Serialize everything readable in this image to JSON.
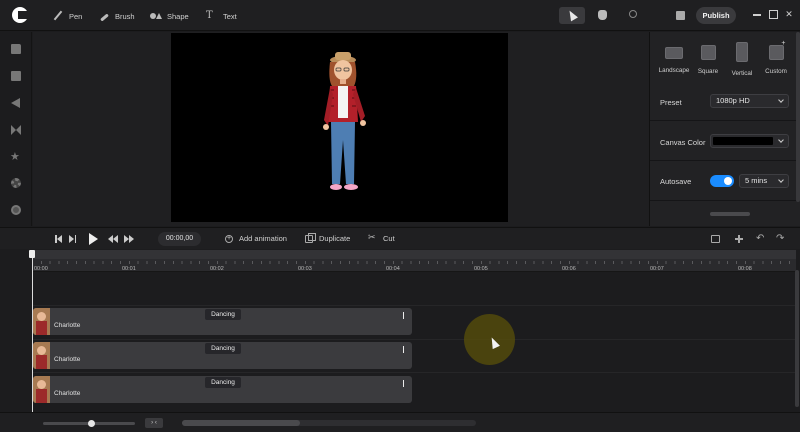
{
  "toolbar": {
    "tools": [
      {
        "label": "Pen",
        "icon": "pen-icon"
      },
      {
        "label": "Brush",
        "icon": "brush-icon"
      },
      {
        "label": "Shape",
        "icon": "shape-icon"
      },
      {
        "label": "Text",
        "icon": "text-icon"
      }
    ],
    "text_glyph": "T",
    "publish_label": "Publish",
    "close_glyph": "✕"
  },
  "right_panel": {
    "ratios": [
      "Landscape",
      "Square",
      "Vertical",
      "Custom"
    ],
    "preset_label": "Preset",
    "preset_value": "1080p HD",
    "canvas_color_label": "Canvas Color",
    "canvas_color": "#000000",
    "autosave_label": "Autosave",
    "autosave_on": true,
    "autosave_interval": "5 mins"
  },
  "transport": {
    "timecode": "00:00,00",
    "add_animation_label": "Add animation",
    "duplicate_label": "Duplicate",
    "cut_label": "Cut",
    "undo_glyph": "↶",
    "redo_glyph": "↷"
  },
  "ruler": {
    "ticks": [
      "00:00",
      "00:01",
      "00:02",
      "00:03",
      "00:04",
      "00:05",
      "00:06",
      "00:07",
      "00:08"
    ]
  },
  "tracks": [
    {
      "name": "Charlotte",
      "animation": "Dancing"
    },
    {
      "name": "Charlotte",
      "animation": "Dancing"
    },
    {
      "name": "Charlotte",
      "animation": "Dancing"
    }
  ],
  "bottom": {
    "fit_label": "› ‹",
    "zoom_level": 0.5
  },
  "colors": {
    "accent": "#1a8cff",
    "background": "#1c1c1e",
    "clip": "#3b3b3e"
  }
}
